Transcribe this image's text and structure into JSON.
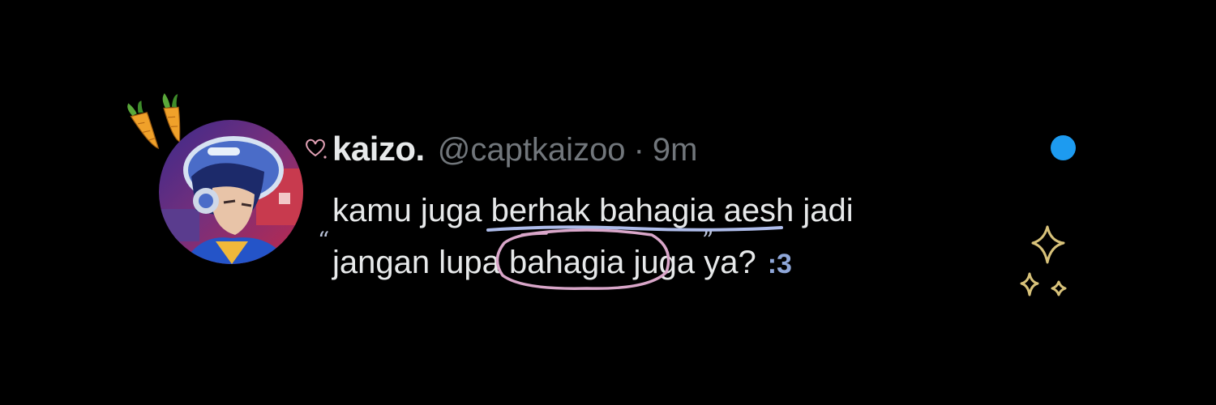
{
  "tweet": {
    "display_name": "kaizo.",
    "handle": "@captkaizoo",
    "separator": "·",
    "time": "9m",
    "body": {
      "line1_before": "kamu juga ",
      "line1_underlined": "berhak bahagia",
      "line1_after": " aesh jadi",
      "line2_before": "jangan lupa ",
      "line2_circled": "bahagia",
      "line2_after": " juga ya?",
      "emoticon": ":3"
    },
    "open_quote": "“",
    "close_quote": "”"
  },
  "colors": {
    "background": "#000000",
    "text_primary": "#e7e9ea",
    "text_secondary": "#71767b",
    "accent_blue": "#1d9bf0",
    "underline_doodle": "#aebcea",
    "circle_doodle": "#d9a6c9",
    "sparkle_doodle": "#d8c27a",
    "heart_doodle": "#e0a0b4"
  },
  "icons": {
    "heart": "heart-doodle-icon",
    "carrots": "carrot-icon",
    "sparkles": "sparkle-icon",
    "unread_dot": "blue-dot-icon"
  }
}
